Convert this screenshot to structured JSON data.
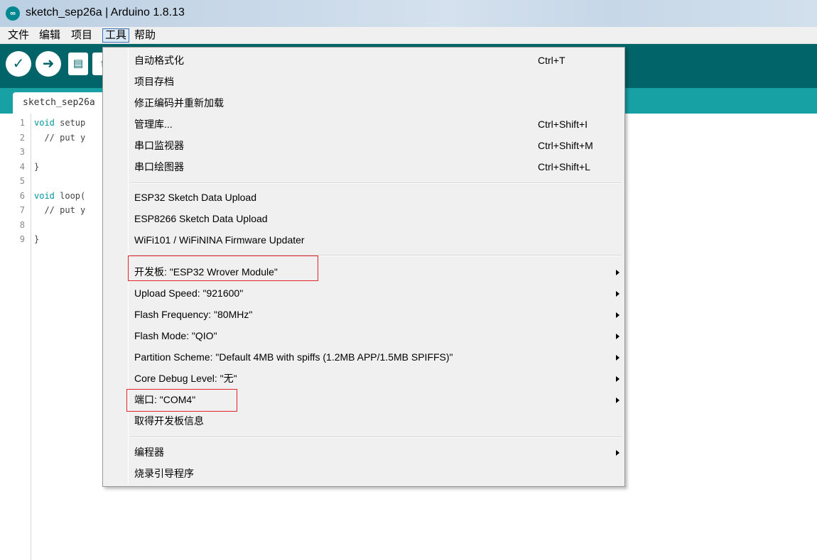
{
  "window": {
    "title": "sketch_sep26a | Arduino 1.8.13",
    "icon": "arduino-icon"
  },
  "menubar": {
    "file": "文件",
    "edit": "编辑",
    "project": "项目",
    "tools": "工具",
    "help": "帮助"
  },
  "toolbar": {
    "verify": "✓",
    "upload": "➜",
    "new": "▤",
    "open": "↑"
  },
  "tab": {
    "name": "sketch_sep26a"
  },
  "editor": {
    "lines": [
      {
        "n": "1",
        "kw": "void",
        "rest": " setup"
      },
      {
        "n": "2",
        "kw": "",
        "rest": "  // put y"
      },
      {
        "n": "3",
        "kw": "",
        "rest": ""
      },
      {
        "n": "4",
        "kw": "",
        "rest": "}"
      },
      {
        "n": "5",
        "kw": "",
        "rest": ""
      },
      {
        "n": "6",
        "kw": "void",
        "rest": " loop("
      },
      {
        "n": "7",
        "kw": "",
        "rest": "  // put y"
      },
      {
        "n": "8",
        "kw": "",
        "rest": ""
      },
      {
        "n": "9",
        "kw": "",
        "rest": "}"
      }
    ]
  },
  "tools_menu": {
    "auto_format": "自动格式化",
    "auto_format_shortcut": "Ctrl+T",
    "archive_sketch": "项目存档",
    "fix_encoding": "修正编码并重新加载",
    "manage_libraries": "管理库...",
    "manage_libraries_shortcut": "Ctrl+Shift+I",
    "serial_monitor": "串口监视器",
    "serial_monitor_shortcut": "Ctrl+Shift+M",
    "serial_plotter": "串口绘图器",
    "serial_plotter_shortcut": "Ctrl+Shift+L",
    "esp32_upload": "ESP32 Sketch Data Upload",
    "esp8266_upload": "ESP8266 Sketch Data Upload",
    "wifi_updater": "WiFi101 / WiFiNINA Firmware Updater",
    "board": "开发板: \"ESP32 Wrover Module\"",
    "upload_speed": "Upload Speed: \"921600\"",
    "flash_frequency": "Flash Frequency: \"80MHz\"",
    "flash_mode": "Flash Mode: \"QIO\"",
    "partition_scheme": "Partition Scheme: \"Default 4MB with spiffs (1.2MB APP/1.5MB SPIFFS)\"",
    "core_debug_level": "Core Debug Level: \"无\"",
    "port": "端口: \"COM4\"",
    "board_info": "取得开发板信息",
    "programmer": "编程器",
    "burn_bootloader": "烧录引导程序"
  },
  "colors": {
    "toolbar": "#006468",
    "tabstrip": "#17a1a5",
    "highlight_box": "#e0262b"
  }
}
